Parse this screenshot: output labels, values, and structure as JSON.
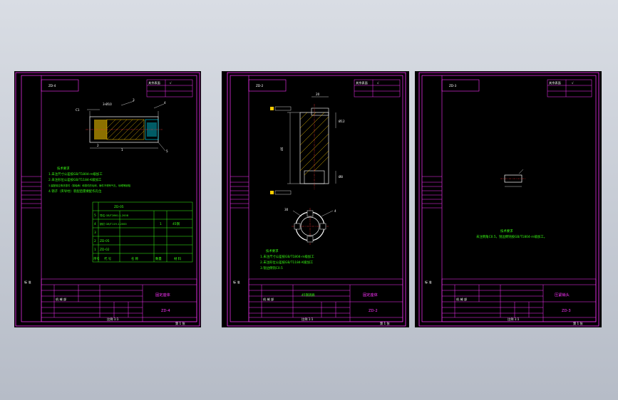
{
  "sheets": [
    {
      "code": "ZD-4",
      "surface_label": "其余表面",
      "dept": "机 械 部",
      "tech_heading": "技术要求",
      "tech_lines": [
        "1.未注尺寸公差按GB/T1804-m级加工",
        "2.未注形位公差按GB/T1184-K级加工",
        "3.装配前应清洗零件（除轴承）和零件的毛刺，铸件不得有气孔、砂眼等缺陷",
        "4.销子（夹导柱）装配后需要配作孔位"
      ],
      "bom_header": "ZD-05",
      "bom_rows": [
        {
          "no": "5",
          "name": "导柱 GB/T2861.1-2008",
          "qty": "",
          "mat": ""
        },
        {
          "no": "4",
          "name": "销钉 GB/T119.1-2000",
          "qty": "1",
          "mat": "45钢"
        },
        {
          "no": "3",
          "name": "",
          "qty": "",
          "mat": ""
        },
        {
          "no": "2",
          "name": "ZD-05",
          "qty": "",
          "mat": ""
        },
        {
          "no": "1",
          "name": "ZD-02",
          "qty": "",
          "mat": ""
        }
      ],
      "bom_foot": [
        "序号",
        "代 号",
        "名 称",
        "数量",
        "材 料"
      ],
      "part_title": "固定座体",
      "drawing_no": "ZD-4",
      "scale_row": "比例 1:1",
      "sheet_no": "第 1 张"
    },
    {
      "code": "ZD-2",
      "surface_label": "其余表面",
      "dept": "机 械 部",
      "tech_heading": "技术要求",
      "tech_lines": [
        "1.未注尺寸公差按GB/T1804-m级加工",
        "2.未注形位公差按GB/T1184-K级加工",
        "3.锐边倒钝C0.5"
      ],
      "part_title": "固定座体",
      "material": "45钢调质",
      "drawing_no": "ZD-2",
      "scale_row": "比例 1:1",
      "sheet_no": "第 1 张",
      "dims": {
        "height": "46",
        "top": "20",
        "d1": "Ø12",
        "d2": "Ø8",
        "sec": "4",
        "w": "30"
      }
    },
    {
      "code": "ZD-3",
      "surface_label": "其余表面",
      "dept": "机 械 部",
      "tech_heading": "技术要求",
      "tech_lines": [
        "未注倒角C0.5，锐边倒钝按GB/T1804-m级加工。"
      ],
      "part_title": "压紧销头",
      "drawing_no": "ZD-3",
      "scale_row": "比例 1:1",
      "sheet_no": "第 1 张"
    }
  ],
  "colors": {
    "frame": "#ff33ff",
    "text": "#39ff14",
    "white": "#ffffff",
    "hatch": "#ffcc00",
    "cyan": "#00e5ff"
  }
}
